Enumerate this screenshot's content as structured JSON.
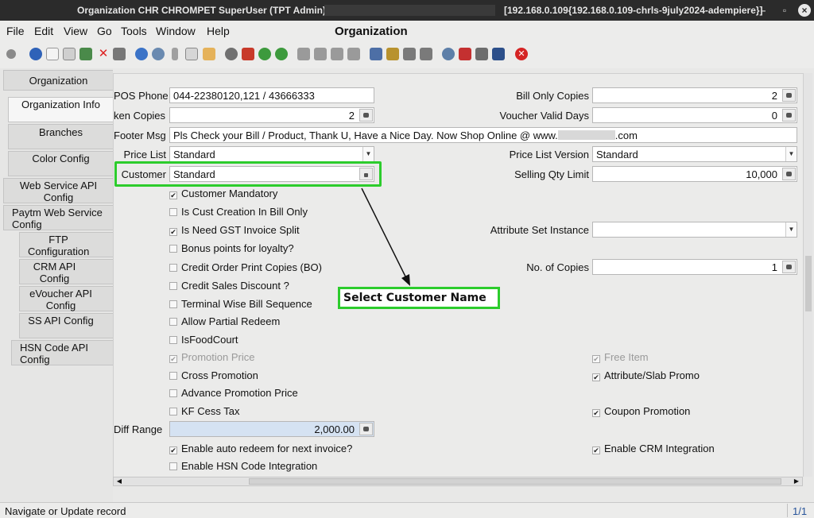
{
  "window": {
    "title": "Organization  CHR  CHROMPET  SuperUser (TPT Admin) @",
    "server": "[192.168.0.109{192.168.0.109-chrls-9july2024-adempiere}]",
    "minimize": "–",
    "maximize": "▫",
    "close": "×"
  },
  "menu": {
    "items": [
      "File",
      "Edit",
      "View",
      "Go",
      "Tools",
      "Window",
      "Help"
    ],
    "window_title": "Organization"
  },
  "toolbar": {
    "icons": [
      "undo-icon",
      "help-icon",
      "new-icon",
      "copy-icon",
      "save-icon",
      "delete-icon",
      "report-icon",
      "refresh-icon",
      "find-icon",
      "attachment-icon",
      "chat-icon",
      "history-icon",
      "archive-icon",
      "home-icon",
      "back-icon",
      "forward-icon",
      "first-icon",
      "previous-icon",
      "next-icon",
      "last-icon",
      "detail-icon",
      "product-icon",
      "print-icon",
      "print-preview-icon",
      "zoom-icon",
      "workflow-icon",
      "request-icon",
      "exit-icon"
    ]
  },
  "tabs": [
    {
      "label": "Organization"
    },
    {
      "label": "Organization Info"
    },
    {
      "label": "Branches"
    },
    {
      "label": "Color Config"
    },
    {
      "label": "Web Service API Config"
    },
    {
      "label": "Paytm Web Service Config"
    },
    {
      "label": "FTP Configuration"
    },
    {
      "label": "CRM API Config"
    },
    {
      "label": "eVoucher API Config"
    },
    {
      "label": "SS API Config"
    },
    {
      "label": "HSN Code API Config"
    }
  ],
  "form": {
    "pos_phone": {
      "label": "POS Phone",
      "value": "044-22380120,121 / 43666333"
    },
    "bill_only_copies": {
      "label": "Bill Only Copies",
      "value": "2"
    },
    "token_copies": {
      "label": "ken Copies",
      "value": "2"
    },
    "voucher_valid_days": {
      "label": "Voucher Valid Days",
      "value": "0"
    },
    "footer_msg": {
      "label": "Footer Msg",
      "value": "Pls Check your Bill / Product, Thank U, Have a Nice Day. Now Shop Online @ www.",
      "suffix": ".com"
    },
    "price_list": {
      "label": "Price List",
      "value": "Standard"
    },
    "price_list_version": {
      "label": "Price List Version",
      "value": "Standard"
    },
    "customer": {
      "label": "Customer",
      "value": "Standard"
    },
    "selling_qty_limit": {
      "label": "Selling Qty Limit",
      "value": "10,000"
    },
    "attribute_set_instance": {
      "label": "Attribute Set Instance",
      "value": ""
    },
    "no_of_copies": {
      "label": "No. of Copies",
      "value": "1"
    },
    "diff_range": {
      "label": "Diff Range",
      "value": "2,000.00"
    },
    "checkboxes_left": [
      {
        "label": "Customer Mandatory",
        "checked": true,
        "disabled": false
      },
      {
        "label": "Is Cust Creation In Bill Only",
        "checked": false,
        "disabled": false
      },
      {
        "label": "Is Need GST Invoice Split",
        "checked": true,
        "disabled": false
      },
      {
        "label": "Bonus points for loyalty?",
        "checked": false,
        "disabled": false
      },
      {
        "label": "Credit Order Print Copies (BO)",
        "checked": false,
        "disabled": false
      },
      {
        "label": "Credit Sales Discount ?",
        "checked": false,
        "disabled": false
      },
      {
        "label": "Terminal Wise Bill Sequence",
        "checked": false,
        "disabled": false
      },
      {
        "label": "Allow Partial Redeem",
        "checked": false,
        "disabled": false
      },
      {
        "label": "IsFoodCourt",
        "checked": false,
        "disabled": false
      },
      {
        "label": "Promotion Price",
        "checked": true,
        "disabled": true
      },
      {
        "label": "Cross Promotion",
        "checked": false,
        "disabled": false
      },
      {
        "label": "Advance Promotion Price",
        "checked": false,
        "disabled": false
      },
      {
        "label": "KF Cess Tax",
        "checked": false,
        "disabled": false
      },
      {
        "label": "Enable auto redeem for next invoice?",
        "checked": true,
        "disabled": false
      },
      {
        "label": "Enable HSN Code Integration",
        "checked": false,
        "disabled": false
      }
    ],
    "checkboxes_right": [
      {
        "label": "Free Item",
        "checked": true,
        "disabled": true
      },
      {
        "label": "Attribute/Slab Promo",
        "checked": true,
        "disabled": false
      },
      {
        "label": "Coupon Promotion",
        "checked": true,
        "disabled": false
      },
      {
        "label": "Enable CRM Integration",
        "checked": true,
        "disabled": false
      }
    ]
  },
  "annotation": {
    "callout": "Select Customer Name",
    "color": "#2ccc2c"
  },
  "status": {
    "message": "Navigate or Update record",
    "record": "1/1"
  }
}
